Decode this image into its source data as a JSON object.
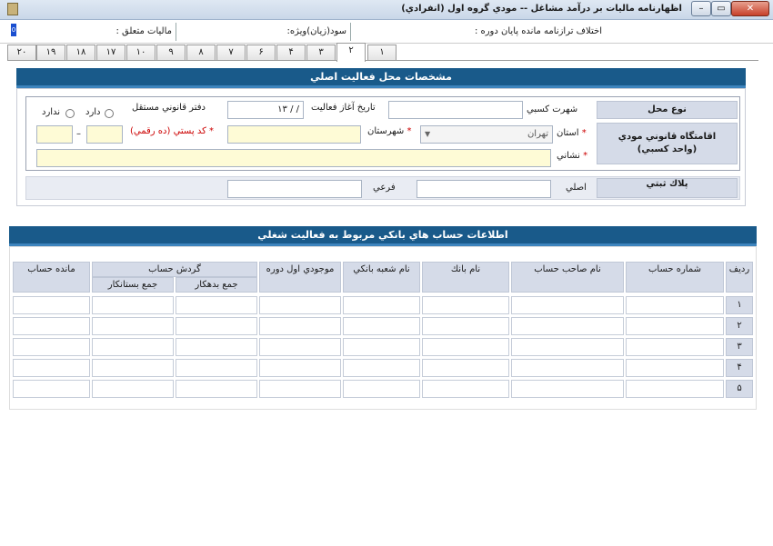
{
  "window": {
    "title": "اظهارنامه ماليات بر درآمد مشاغل -- مودي گروه اول (انفرادي)",
    "close_label": "✕",
    "maximize_label": "▭",
    "minimize_label": "–"
  },
  "summary": {
    "diff_label": "اختلاف ترازنامه مانده پايان دوره :",
    "profit_label": "سود(زيان)ويژه:",
    "tax_label": "ماليات متعلق :",
    "flag_value": "0"
  },
  "tabs": [
    "۱",
    "۲",
    "۳",
    "۴",
    "۶",
    "۷",
    "۸",
    "۹",
    "۱۰",
    "۱۷",
    "۱۸",
    "۱۹",
    "۲۰"
  ],
  "section1": {
    "title": "مشخصات محل فعاليت اصلي",
    "location_type_label": "نوع محل",
    "residence_label": "اقامتگاه قانوني مودي\n(واحد كسبي)",
    "plaque_label": "پلاك ثبتي",
    "business_fame_label": "شهرت كسبي",
    "start_date_label": "تاريخ آغاز فعاليت",
    "start_date_value": "/ / ۱۳",
    "office_label": "دفتر قانوني مستقل",
    "has_label": "دارد",
    "has_not_label": "ندارد",
    "province_label": "استان",
    "province_value": "تهران",
    "city_label": "شهرستان",
    "postal_label": "كد پستي (ده رقمي)",
    "postal_dash": "–",
    "address_label": "نشاني",
    "main_label": "اصلي",
    "sub_label": "فرعي",
    "required_mark": "*"
  },
  "section2": {
    "title": "اطلاعات حساب هاي بانكي مربوط به فعاليت شغلي",
    "columns": {
      "row": "رديف",
      "account_no": "شماره حساب",
      "owner": "نام صاحب حساب",
      "bank": "نام بانك",
      "branch": "نام شعبه بانكي",
      "opening": "موجودي اول دوره",
      "turnover": "گردش حساب",
      "debit": "جمع بدهكار",
      "credit": "جمع بستانكار",
      "balance": "مانده حساب"
    },
    "rows": [
      "۱",
      "۲",
      "۳",
      "۴",
      "۵"
    ]
  },
  "colors": {
    "header_blue": "#195a8a",
    "label_bg": "#d5dbe8",
    "required_bg": "#fefbd6"
  }
}
